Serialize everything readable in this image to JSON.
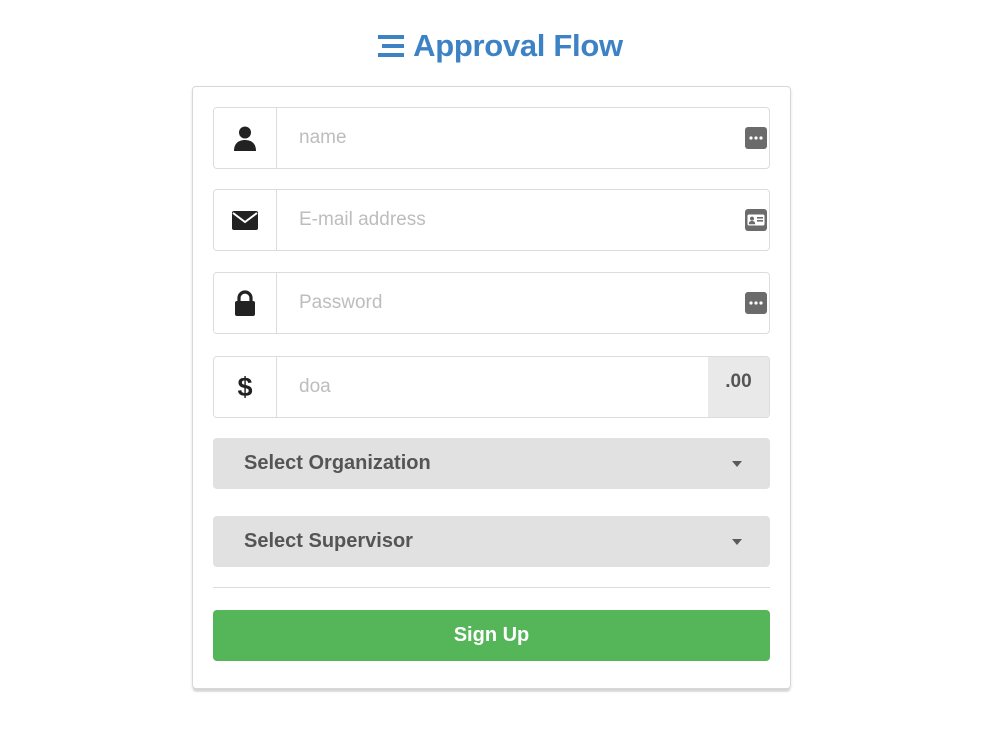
{
  "header": {
    "title": "Approval Flow",
    "icon": "bars-icon",
    "brand_color": "#3d82c4"
  },
  "form": {
    "name": {
      "placeholder": "name",
      "icon": "user-icon",
      "badge": "ellipsis-badge-icon"
    },
    "email": {
      "placeholder": "E-mail address",
      "icon": "envelope-icon",
      "badge": "id-card-icon"
    },
    "password": {
      "placeholder": "Password",
      "icon": "lock-icon",
      "badge": "ellipsis-badge-icon"
    },
    "doa": {
      "placeholder": "doa",
      "icon": "dollar-icon",
      "suffix": ".00"
    },
    "organization": {
      "label": "Select Organization"
    },
    "supervisor": {
      "label": "Select Supervisor"
    },
    "submit_label": "Sign Up"
  },
  "colors": {
    "submit": "#55b559",
    "select_bg": "#e1e1e2",
    "icon": "#222222"
  }
}
